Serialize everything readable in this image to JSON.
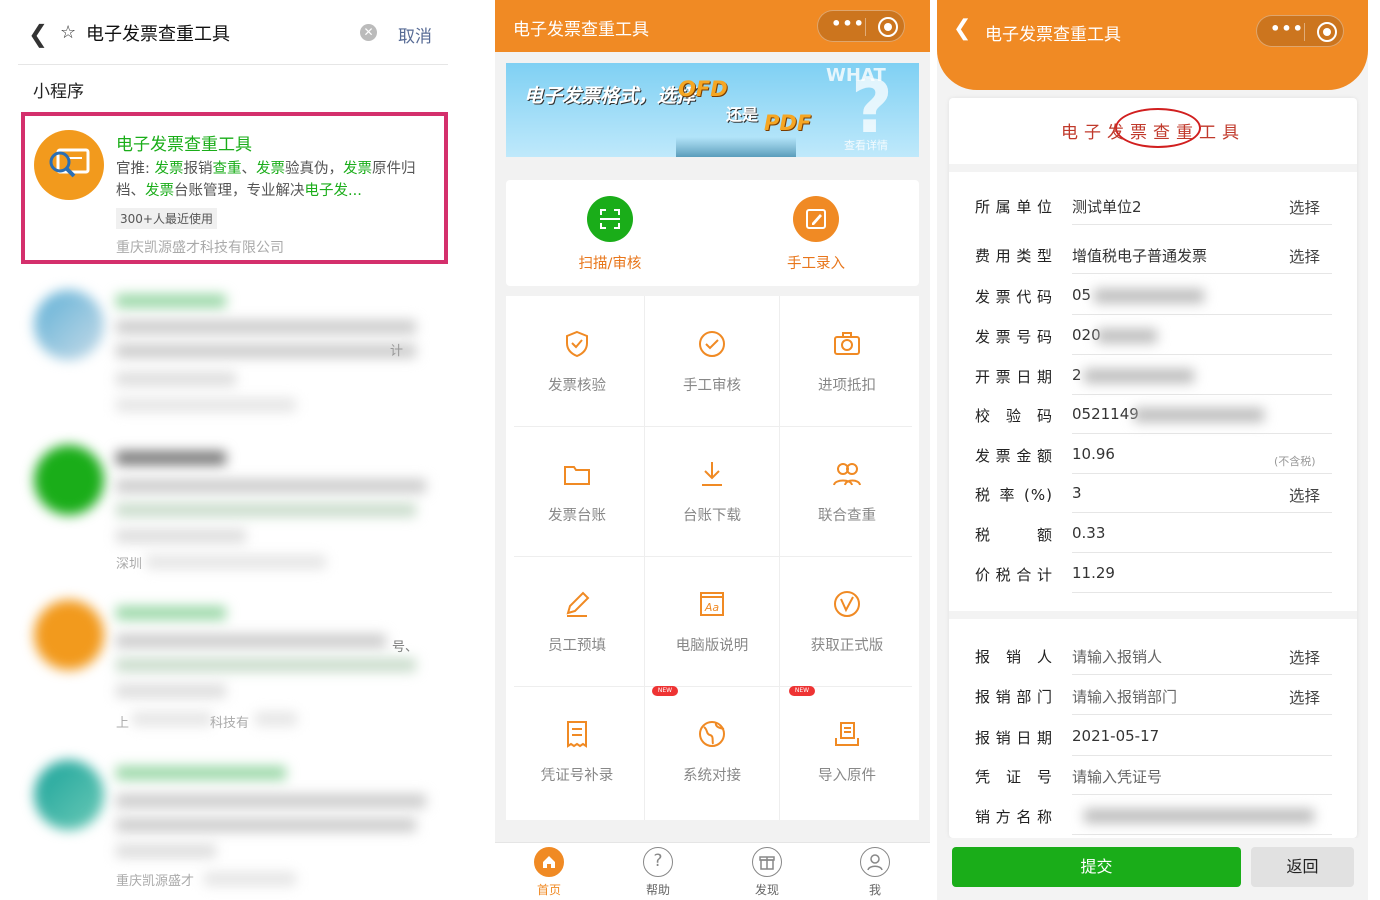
{
  "search_screen": {
    "query": "电子发票查重工具",
    "cancel_label": "取消",
    "section_title": "小程序",
    "first_result": {
      "title": "电子发票查重工具",
      "desc_segments": [
        {
          "t": "官推: ",
          "g": false
        },
        {
          "t": "发票",
          "g": true
        },
        {
          "t": "报销",
          "g": false
        },
        {
          "t": "查重",
          "g": true
        },
        {
          "t": "、",
          "g": false
        },
        {
          "t": "发票",
          "g": true
        },
        {
          "t": "验真伪，",
          "g": false
        },
        {
          "t": "发票",
          "g": true
        },
        {
          "t": "原件归档、",
          "g": false
        },
        {
          "t": "发票",
          "g": true
        },
        {
          "t": "台账管理，专业解决",
          "g": false
        },
        {
          "t": "电子发...",
          "g": true
        }
      ],
      "badge": "300+人最近使用",
      "company": "重庆凯源盛才科技有限公司"
    },
    "blurred_fragments": [
      "计",
      "深圳",
      "号、",
      "上",
      "科技有",
      "重庆凯源盛才"
    ]
  },
  "home_screen": {
    "title": "电子发票查重工具",
    "banner": {
      "line1": "电子发票格式，选择",
      "ofd": "OFD",
      "haishi": "还是",
      "pdf": "PDF",
      "what": "WHAT",
      "detail": "查看详情"
    },
    "primary_actions": [
      {
        "label": "扫描/审核",
        "icon": "scan-icon",
        "color": "#1aad19"
      },
      {
        "label": "手工录入",
        "icon": "edit-icon",
        "color": "#f08a24"
      }
    ],
    "grid_items": [
      {
        "label": "发票核验",
        "icon": "shield-check-icon",
        "new": false
      },
      {
        "label": "手工审核",
        "icon": "check-circle-icon",
        "new": false
      },
      {
        "label": "进项抵扣",
        "icon": "camera-icon",
        "new": false
      },
      {
        "label": "发票台账",
        "icon": "folder-icon",
        "new": false
      },
      {
        "label": "台账下载",
        "icon": "download-icon",
        "new": false
      },
      {
        "label": "联合查重",
        "icon": "users-icon",
        "new": false
      },
      {
        "label": "员工预填",
        "icon": "pencil-icon",
        "new": false
      },
      {
        "label": "电脑版说明",
        "icon": "font-doc-icon",
        "new": false
      },
      {
        "label": "获取正式版",
        "icon": "version-icon",
        "new": false
      },
      {
        "label": "凭证号补录",
        "icon": "receipt-icon",
        "new": false
      },
      {
        "label": "系统对接",
        "icon": "globe-icon",
        "new": true
      },
      {
        "label": "导入原件",
        "icon": "import-doc-icon",
        "new": true
      }
    ],
    "new_tag": "NEW",
    "tabs": [
      {
        "label": "首页",
        "icon": "home-icon",
        "active": true
      },
      {
        "label": "帮助",
        "icon": "help-icon",
        "active": false
      },
      {
        "label": "发现",
        "icon": "gift-icon",
        "active": false
      },
      {
        "label": "我",
        "icon": "user-icon",
        "active": false
      }
    ],
    "accent_color": "#f08a24"
  },
  "form_screen": {
    "title": "电子发票查重工具",
    "card_title": "电子发票查重工具",
    "fields": [
      {
        "label": "所属单位",
        "value": "测试单位2",
        "select": "选择",
        "placeholder": false,
        "note": ""
      },
      {
        "label": "费用类型",
        "value": "增值税电子普通发票",
        "select": "选择",
        "placeholder": false,
        "note": ""
      },
      {
        "label": "发票代码",
        "value": "05",
        "select": "",
        "placeholder": false,
        "note": ""
      },
      {
        "label": "发票号码",
        "value": "020",
        "select": "",
        "placeholder": false,
        "note": ""
      },
      {
        "label": "开票日期",
        "value": "2",
        "select": "",
        "placeholder": false,
        "note": ""
      },
      {
        "label": "校 验 码",
        "value": "0521149",
        "select": "",
        "placeholder": false,
        "note": ""
      },
      {
        "label": "发票金额",
        "value": "10.96",
        "select": "",
        "placeholder": false,
        "note": "(不含税)"
      },
      {
        "label": "税 率 (%)",
        "value": "3",
        "select": "选择",
        "placeholder": false,
        "note": ""
      },
      {
        "label": "税 额",
        "value": "0.33",
        "select": "",
        "placeholder": false,
        "note": ""
      },
      {
        "label": "价税合计",
        "value": "11.29",
        "select": "",
        "placeholder": false,
        "note": ""
      }
    ],
    "fields2": [
      {
        "label": "报 销 人",
        "value": "请输入报销人",
        "select": "选择",
        "placeholder": true
      },
      {
        "label": "报销部门",
        "value": "请输入报销部门",
        "select": "选择",
        "placeholder": true
      },
      {
        "label": "报销日期",
        "value": "2021-05-17",
        "select": "",
        "placeholder": false
      },
      {
        "label": "凭 证 号",
        "value": "请输入凭证号",
        "select": "",
        "placeholder": true
      },
      {
        "label": "销方名称",
        "value": "",
        "select": "",
        "placeholder": false
      }
    ],
    "submit_label": "提交",
    "back_label": "返回",
    "submit_color": "#1aad19"
  }
}
